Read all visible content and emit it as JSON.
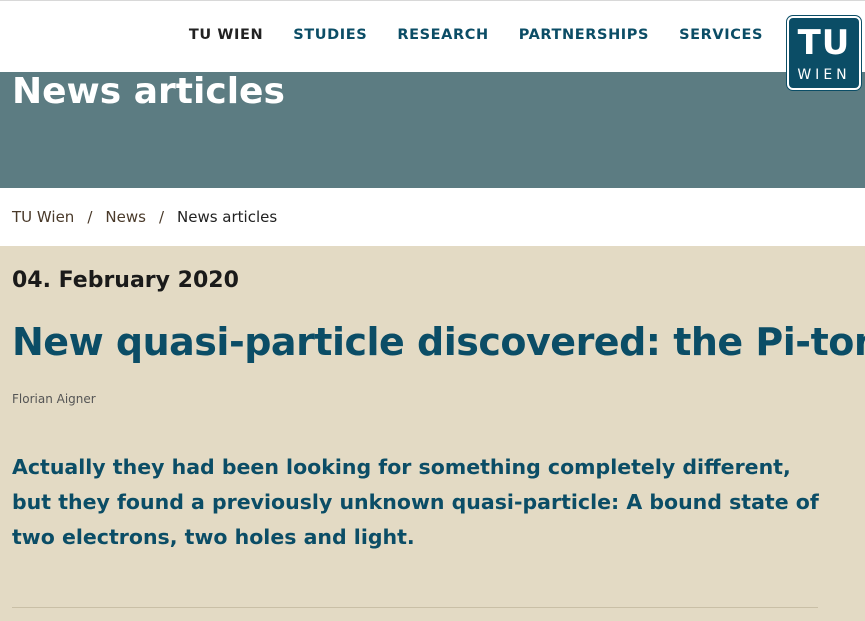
{
  "header": {
    "nav": [
      "TU WIEN",
      "STUDIES",
      "RESEARCH",
      "PARTNERSHIPS",
      "SERVICES"
    ],
    "logo": {
      "top": "TU",
      "bottom": "WIEN"
    }
  },
  "hero": {
    "title": "News articles"
  },
  "breadcrumb": {
    "items": [
      "TU Wien",
      "News",
      "News articles"
    ],
    "separator": "/"
  },
  "article": {
    "date": "04. February 2020",
    "title": "New quasi-particle discovered: the Pi-ton",
    "author": "Florian Aigner",
    "lead": "Actually they had been looking for something completely different, but they found a previously unknown quasi-particle: A bound state of two electrons, two holes and light."
  },
  "colors": {
    "brand": "#0b4d66",
    "hero_bg": "#5c7c82",
    "page_bg": "#e3dac4"
  }
}
